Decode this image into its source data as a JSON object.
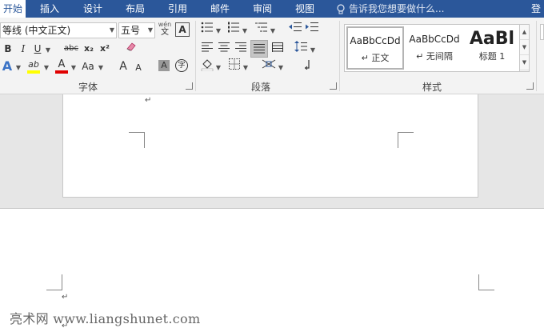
{
  "tabs": [
    "开始",
    "插入",
    "设计",
    "布局",
    "引用",
    "邮件",
    "审阅",
    "视图"
  ],
  "tell_me": "告诉我您想要做什么...",
  "login_label": "登",
  "font": {
    "name": "等线 (中文正文)",
    "size": "五号",
    "group_label": "字体",
    "wen_icon_top": "wén",
    "wen_icon_bottom": "文",
    "bold": "B",
    "italic": "I",
    "underline": "U",
    "strike": "abc",
    "subscript": "x₂",
    "superscript": "x²",
    "text_effect": "A",
    "highlight": "ab",
    "font_color": "A",
    "change_case": "Aa",
    "grow": "A",
    "shrink": "A",
    "char_shading": "A",
    "enclosed": "字",
    "border_char": "A"
  },
  "paragraph": {
    "group_label": "段落"
  },
  "styles": {
    "group_label": "样式",
    "items": [
      {
        "sample": "AaBbCcDd",
        "name": "↵ 正文"
      },
      {
        "sample": "AaBbCcDd",
        "name": "↵ 无间隔"
      },
      {
        "sample": "AaBl",
        "name": "标题 1"
      }
    ]
  },
  "document": {
    "paragraph_mark": "↵",
    "watermark": "亮术网 www.liangshunet.com"
  },
  "colors": {
    "tab_bar": "#2b579a",
    "ribbon": "#f3f3f3",
    "doc_background": "#e6e6e6",
    "highlight_yellow": "#ffff00",
    "font_color_red": "#e00000"
  }
}
